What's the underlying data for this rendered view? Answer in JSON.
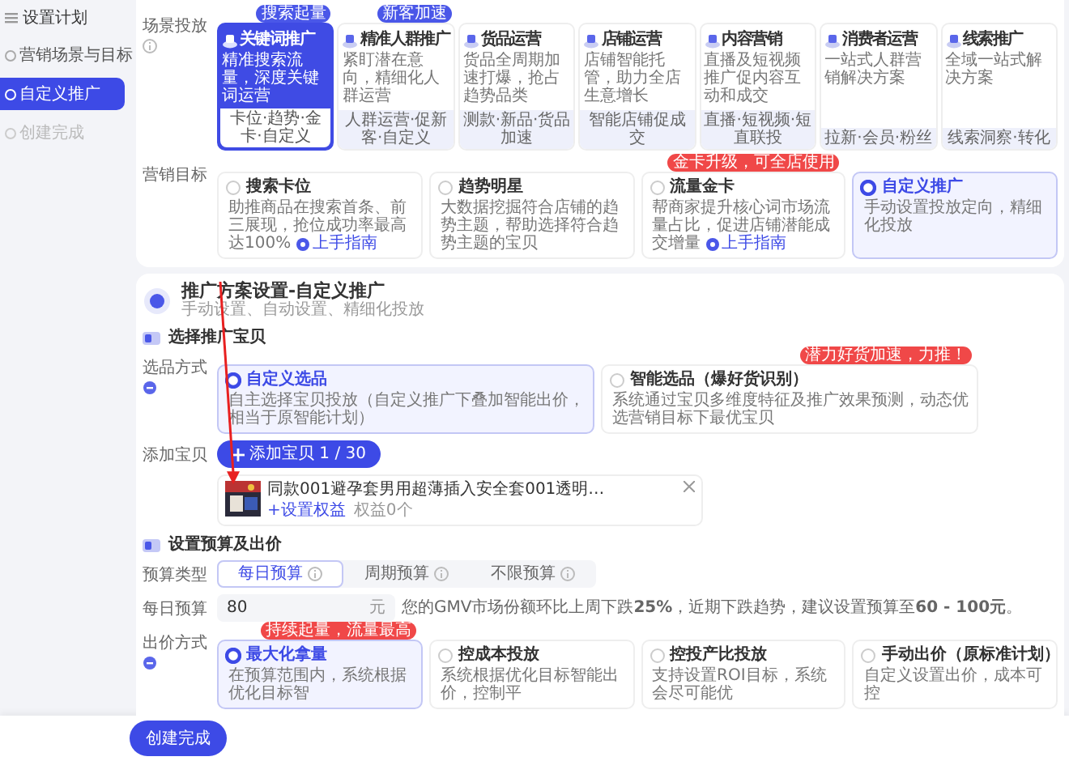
{
  "sidebar": {
    "title": "设置计划",
    "steps": [
      {
        "label": "营销场景与目标",
        "selected": false,
        "disabled": false
      },
      {
        "label": "自定义推广",
        "selected": true,
        "disabled": false
      },
      {
        "label": "创建完成",
        "selected": false,
        "disabled": true
      }
    ]
  },
  "scene": {
    "label": "场景投放",
    "cards": [
      {
        "title": "关键词推广",
        "badge": "搜索起量",
        "desc": "精准搜索流量，深度关键词运营",
        "tags": "卡位·趋势·金卡·自定义",
        "selected": true
      },
      {
        "title": "精准人群推广",
        "badge": "新客加速",
        "desc": "紧盯潜在意向，精细化人群运营",
        "tags": "人群运营·促新客·自定义",
        "selected": false
      },
      {
        "title": "货品运营",
        "desc": "货品全周期加速打爆，抢占趋势品类",
        "tags": "测款·新品·货品加速",
        "selected": false
      },
      {
        "title": "店铺运营",
        "desc": "店铺智能托管，助力全店生意增长",
        "tags": "智能店铺促成交",
        "selected": false
      },
      {
        "title": "内容营销",
        "desc": "直播及短视频推广促内容互动和成交",
        "tags": "直播·短视频·短直联投",
        "selected": false
      },
      {
        "title": "消费者运营",
        "desc": "一站式人群营销解决方案",
        "tags": "拉新·会员·粉丝",
        "selected": false
      },
      {
        "title": "线索推广",
        "desc": "全域一站式解决方案",
        "tags": "线索洞察·转化",
        "selected": false
      }
    ]
  },
  "goal": {
    "label": "营销目标",
    "options": [
      {
        "title": "搜索卡位",
        "desc": "助推商品在搜索首条、前三展现，抢位成功率最高达100%",
        "link": "上手指南",
        "selected": false
      },
      {
        "title": "趋势明星",
        "desc": "大数据挖掘符合店铺的趋势主题，帮助选择符合趋势主题的宝贝",
        "selected": false
      },
      {
        "title": "流量金卡",
        "badge": "金卡升级，可全店使用",
        "desc": "帮商家提升核心词市场流量占比，促进店铺潜能成交增量",
        "link": "上手指南",
        "selected": false
      },
      {
        "title": "自定义推广",
        "desc": "手动设置投放定向，精细化投放",
        "selected": true
      }
    ]
  },
  "plan": {
    "title": "推广方案设置-自定义推广",
    "subtitle": "手动设置、自动设置、精细化投放",
    "product_section": {
      "title": "选择推广宝贝",
      "method_label": "选品方式",
      "methods": [
        {
          "title": "自定义选品",
          "desc": "自主选择宝贝投放（自定义推广下叠加智能出价，相当于原智能计划）",
          "selected": true
        },
        {
          "title": "智能选品（爆好货识别）",
          "badge": "潜力好货加速，力推！",
          "desc": "系统通过宝贝多维度特征及推广效果预测，动态优选营销目标下最优宝贝",
          "selected": false
        }
      ],
      "add_label": "添加宝贝",
      "add_button": "添加宝贝 1 / 30",
      "products": [
        {
          "name": "同款001避孕套男用超薄插入安全套001透明…",
          "rights_link": "+设置权益",
          "rights": "权益0个"
        }
      ]
    },
    "budget_section": {
      "title": "设置预算及出价",
      "type_label": "预算类型",
      "types": [
        {
          "label": "每日预算",
          "selected": true
        },
        {
          "label": "周期预算",
          "selected": false
        },
        {
          "label": "不限预算",
          "selected": false
        }
      ],
      "daily_label": "每日预算",
      "daily_value": "80",
      "unit": "元",
      "hint": "您的GMV市场份额环比上周下跌**25%**，近期下跌趋势，建议设置预算至**60 - 100元**。",
      "bid_label": "出价方式",
      "bids": [
        {
          "title": "最大化拿量",
          "badge": "持续起量，流量最高",
          "desc": "在预算范围内，系统根据优化目标智",
          "selected": true
        },
        {
          "title": "控成本投放",
          "desc": "系统根据优化目标智能出价，控制平",
          "selected": false
        },
        {
          "title": "控投产比投放",
          "desc": "支持设置ROI目标，系统会尽可能优",
          "selected": false
        },
        {
          "title": "手动出价（原标准计划）",
          "desc": "自定义设置出价，成本可控",
          "selected": false
        }
      ]
    }
  },
  "footer": {
    "button": "创建完成"
  }
}
